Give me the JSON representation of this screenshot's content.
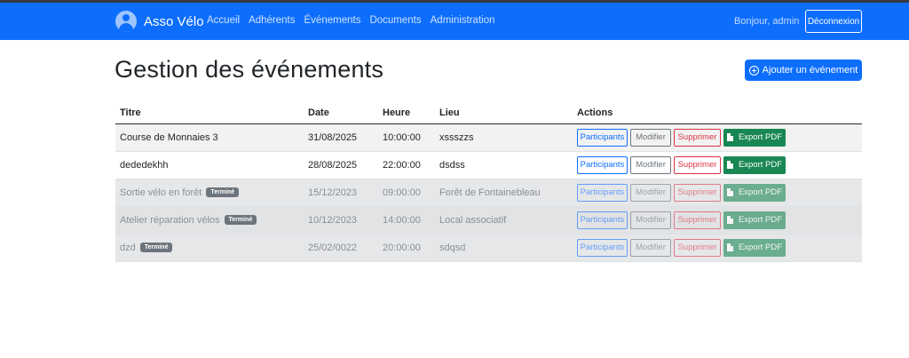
{
  "navbar": {
    "brand": "Asso Vélo",
    "links": [
      "Accueil",
      "Adhérents",
      "Événements",
      "Documents",
      "Administration"
    ],
    "greeting": "Bonjour, admin",
    "logout": "Déconnexion",
    "color": "#0d6efd"
  },
  "page": {
    "title": "Gestion des événements",
    "add_button": "Ajouter un événement"
  },
  "table": {
    "headers": [
      "Titre",
      "Date",
      "Heure",
      "Lieu",
      "Actions"
    ],
    "rows": [
      {
        "title": "Course de Monnaies 3",
        "date": "31/08/2025",
        "time": "10:00:00",
        "place": "xssszzs",
        "badge": ""
      },
      {
        "title": "dededekhh",
        "date": "28/08/2025",
        "time": "22:00:00",
        "place": "dsdss",
        "badge": ""
      },
      {
        "title": "Sortie vélo en forêt",
        "date": "15/12/2023",
        "time": "09:00:00",
        "place": "Forêt de Fontainebleau",
        "badge": "Terminé"
      },
      {
        "title": "Atelier réparation vélos",
        "date": "10/12/2023",
        "time": "14:00:00",
        "place": "Local associatif",
        "badge": "Terminé"
      },
      {
        "title": "dzd",
        "date": "25/02/0022",
        "time": "20:00:00",
        "place": "sdqsd",
        "badge": "Terminé"
      }
    ],
    "actions": {
      "participants": "Participants",
      "edit": "Modifier",
      "delete": "Supprimer",
      "export": "Export PDF"
    }
  }
}
